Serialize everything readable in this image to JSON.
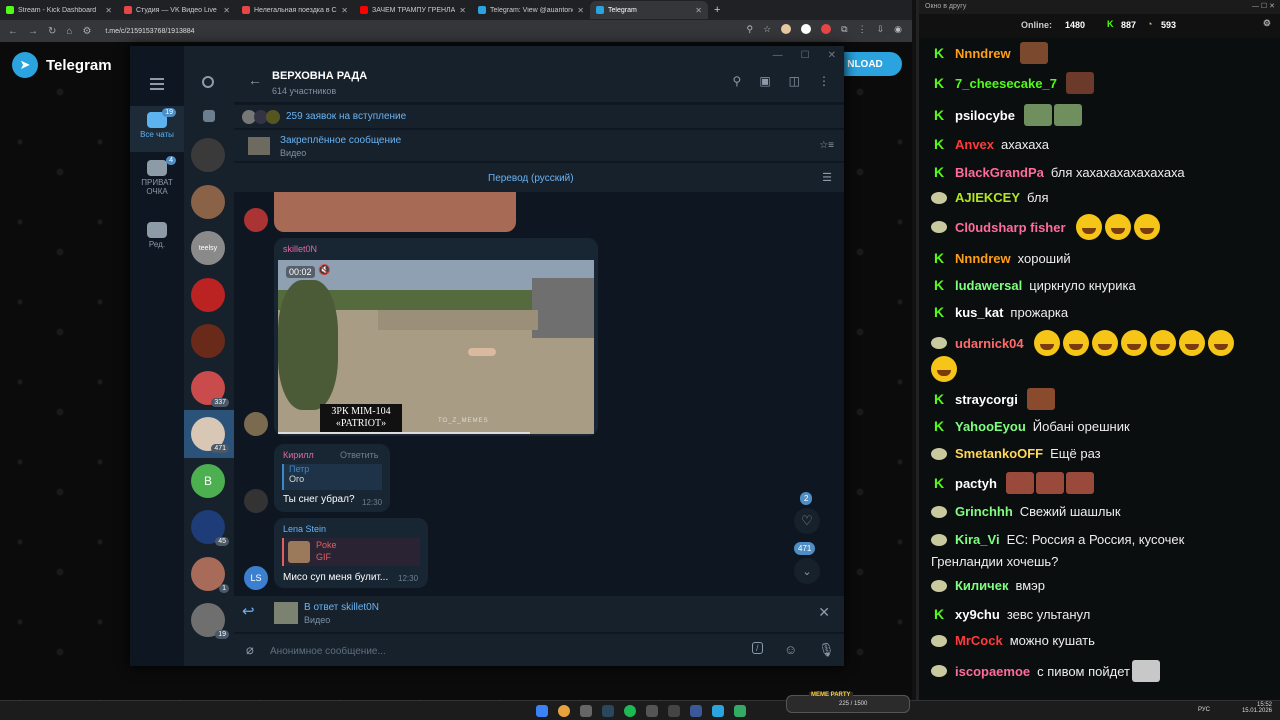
{
  "browser": {
    "tabs": [
      {
        "title": "Stream - Kick Dashboard",
        "color": "#53fc18",
        "active": false
      },
      {
        "title": "Студия — VK Видео Live",
        "color": "#e64646",
        "active": false
      },
      {
        "title": "Нелегальная поездка в Сири",
        "color": "#e64646",
        "active": false
      },
      {
        "title": "ЗАЧЕМ ТРАМПУ ГРЕНЛАНДИЯ",
        "color": "#ff0000",
        "active": false
      },
      {
        "title": "Telegram: View @auantonov",
        "color": "#2aa3df",
        "active": false
      },
      {
        "title": "Telegram",
        "color": "#2aa3df",
        "active": true
      }
    ],
    "url": "t.me/c/2159153768/1913884"
  },
  "telegram_page": {
    "brand": "Telegram",
    "download_label": "NLOAD"
  },
  "folders": [
    {
      "label": "Все чаты",
      "badge": "19",
      "active": true
    },
    {
      "label": "ПРИВАТ ОЧКА",
      "badge": "4",
      "active": false
    },
    {
      "label": "Ред.",
      "badge": "",
      "active": false
    }
  ],
  "chatlist": {
    "avatars": [
      {
        "badge": "",
        "color": "#3a3a3a"
      },
      {
        "badge": "",
        "color": "#8a6248"
      },
      {
        "badge": "",
        "color": "#8a8a8a",
        "text": "teelsy"
      },
      {
        "badge": "",
        "color": "#bb2222"
      },
      {
        "badge": "",
        "color": "#6a2a1a"
      },
      {
        "badge": "337",
        "color": "#c94b4b"
      },
      {
        "badge": "471",
        "color": "#d9c7b5"
      },
      {
        "badge": "",
        "color": "#4caf50",
        "text": "B"
      },
      {
        "badge": "45",
        "color": "#1e3c78"
      },
      {
        "badge": "1",
        "color": "#a86b5a"
      },
      {
        "badge": "19",
        "color": "#6f6f6f"
      }
    ]
  },
  "chat": {
    "title": "ВЕРХОВНА РАДА",
    "subtitle": "614 участников",
    "join_requests": "259 заявок на вступление",
    "pinned_title": "Закреплённое сообщение",
    "pinned_sub": "Видео",
    "translate": "Перевод (русский)",
    "video_msg": {
      "sender": "skillet0N",
      "timer": "00:02",
      "caption_line1": "ЗРК MIM-104",
      "caption_line2": "«PATRIOT»",
      "watermark": "TO_Z_MEMES"
    },
    "msg_kirill": {
      "sender": "Кирилл",
      "reply_action": "Ответить",
      "quote_name": "Петр",
      "quote_text": "Ого",
      "text": "Ты снег убрал?",
      "time": "12:30"
    },
    "msg_lena": {
      "sender": "Lena Stein",
      "avatar_text": "LS",
      "quote_name": "Poke",
      "quote_text": "GIF",
      "text": "Мисо суп меня булит...",
      "time": "12:30"
    },
    "fab_heart_count": "2",
    "fab_down_count": "471",
    "reply_to": "В ответ skillet0N",
    "reply_sub": "Видео",
    "composer_placeholder": "Анонимное сообщение..."
  },
  "kick": {
    "window_title": "Окно в другу",
    "online_label": "Online:",
    "online_count": "1480",
    "stat1": "887",
    "stat2": "593",
    "messages": [
      {
        "icon": "k",
        "name": "Nnndrew",
        "color": "#ff9f1a",
        "text": "",
        "emotes": [
          "#7b4a2e"
        ]
      },
      {
        "icon": "k",
        "name": "7_cheesecake_7",
        "color": "#53fc18",
        "text": "",
        "emotes": [
          "#6b3a2a"
        ]
      },
      {
        "icon": "k",
        "name": "psilocybe",
        "color": "#ffffff",
        "text": "",
        "emotes": [
          "#6f8f5f",
          "#6f8f5f"
        ]
      },
      {
        "icon": "k",
        "name": "Anvex",
        "color": "#ff3b3b",
        "text": "ахахаха",
        "emotes": []
      },
      {
        "icon": "k",
        "name": "BlackGrandPa",
        "color": "#ff6b9a",
        "text": "бля хахахахахахахаха",
        "emotes": []
      },
      {
        "icon": "m",
        "name": "AJIEKCEY",
        "color": "#b5e61d",
        "text": "бля",
        "emotes": []
      },
      {
        "icon": "m",
        "name": "Cl0udsharp fisher",
        "color": "#ff6b9a",
        "text": "",
        "emojis": 3
      },
      {
        "icon": "k",
        "name": "Nnndrew",
        "color": "#ff9f1a",
        "text": "хороший",
        "emotes": []
      },
      {
        "icon": "k",
        "name": "ludawersal",
        "color": "#7fff7f",
        "text": "циркнуло кнурика",
        "emotes": []
      },
      {
        "icon": "k",
        "name": "kus_kat",
        "color": "#ffffff",
        "text": "прожарка",
        "emotes": []
      },
      {
        "icon": "m",
        "name": "udarnick04",
        "color": "#ff6b6b",
        "text": "",
        "emojis": 7
      },
      {
        "icon": "k",
        "name": "straycorgi",
        "color": "#ffffff",
        "text": "",
        "emotes": [
          "#8a4a2e"
        ]
      },
      {
        "icon": "k",
        "name": "YahooEyou",
        "color": "#7fff7f",
        "text": "Йобані орешник",
        "emotes": []
      },
      {
        "icon": "m",
        "name": "SmetankoOFF",
        "color": "#ffd75a",
        "text": "Ещё раз",
        "emotes": []
      },
      {
        "icon": "k",
        "name": "pactyh",
        "color": "#ffffff",
        "text": "",
        "emotes": [
          "#9a4a3a",
          "#9a4a3a",
          "#9a4a3a"
        ]
      },
      {
        "icon": "m",
        "name": "Grinchhh",
        "color": "#7fff7f",
        "text": "Свежий шашлык",
        "emotes": []
      },
      {
        "icon": "m",
        "name": "Kira_Vi",
        "color": "#7fff7f",
        "text": "ЕС: Россия а Россия, кусочек",
        "text2": "Гренландии хочешь?",
        "emotes": []
      },
      {
        "icon": "m",
        "name": "Киличек",
        "color": "#7fff7f",
        "text": "вмэр",
        "emotes": []
      },
      {
        "icon": "k",
        "name": "xy9chu",
        "color": "#ffffff",
        "text": "зевс ультанул",
        "emotes": []
      },
      {
        "icon": "m",
        "name": "MrCock",
        "color": "#ff3b3b",
        "text": "можно кушать",
        "emotes": []
      },
      {
        "icon": "m",
        "name": "iscopaemoe",
        "color": "#ff6b9a",
        "text": "с пивом пойдет",
        "emotes": [
          "#c8c8c8"
        ]
      }
    ]
  },
  "taskbar": {
    "lang": "РУС",
    "time": "15:52",
    "date": "15.01.2026",
    "overlay_text": "MEME PARTY",
    "overlay_progress": "225 / 1500"
  }
}
